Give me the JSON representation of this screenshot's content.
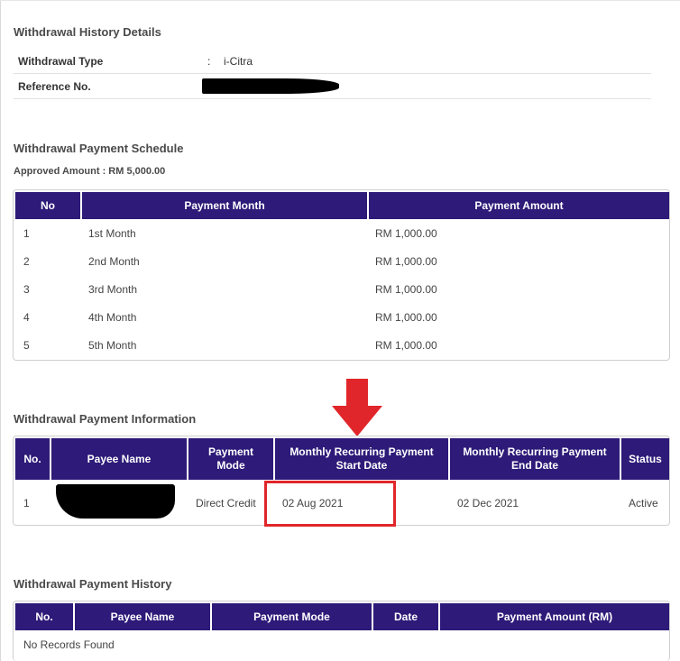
{
  "details": {
    "title": "Withdrawal History Details",
    "rows": [
      {
        "label": "Withdrawal Type",
        "colon": ":",
        "value": "i-Citra"
      },
      {
        "label": "Reference No.",
        "colon": "",
        "value": ""
      }
    ]
  },
  "schedule": {
    "title": "Withdrawal Payment Schedule",
    "approved": "Approved Amount : RM 5,000.00",
    "headers": [
      "No",
      "Payment Month",
      "Payment Amount"
    ],
    "rows": [
      [
        "1",
        "1st Month",
        "RM 1,000.00"
      ],
      [
        "2",
        "2nd Month",
        "RM 1,000.00"
      ],
      [
        "3",
        "3rd Month",
        "RM 1,000.00"
      ],
      [
        "4",
        "4th Month",
        "RM 1,000.00"
      ],
      [
        "5",
        "5th Month",
        "RM 1,000.00"
      ]
    ]
  },
  "info": {
    "title": "Withdrawal Payment Information",
    "headers": [
      "No.",
      "Payee Name",
      "Payment\nMode",
      "Monthly Recurring Payment\nStart Date",
      "Monthly Recurring Payment\nEnd Date",
      "Status"
    ],
    "row": {
      "no": "1",
      "payee": "",
      "mode": "Direct Credit",
      "start": "02 Aug 2021",
      "end": "02 Dec 2021",
      "status": "Active"
    }
  },
  "history": {
    "title": "Withdrawal Payment History",
    "headers": [
      "No.",
      "Payee Name",
      "Payment Mode",
      "Date",
      "Payment Amount (RM)"
    ],
    "empty": "No Records Found"
  },
  "colors": {
    "header_bg": "#2e1a78",
    "highlight": "#e0262a"
  }
}
